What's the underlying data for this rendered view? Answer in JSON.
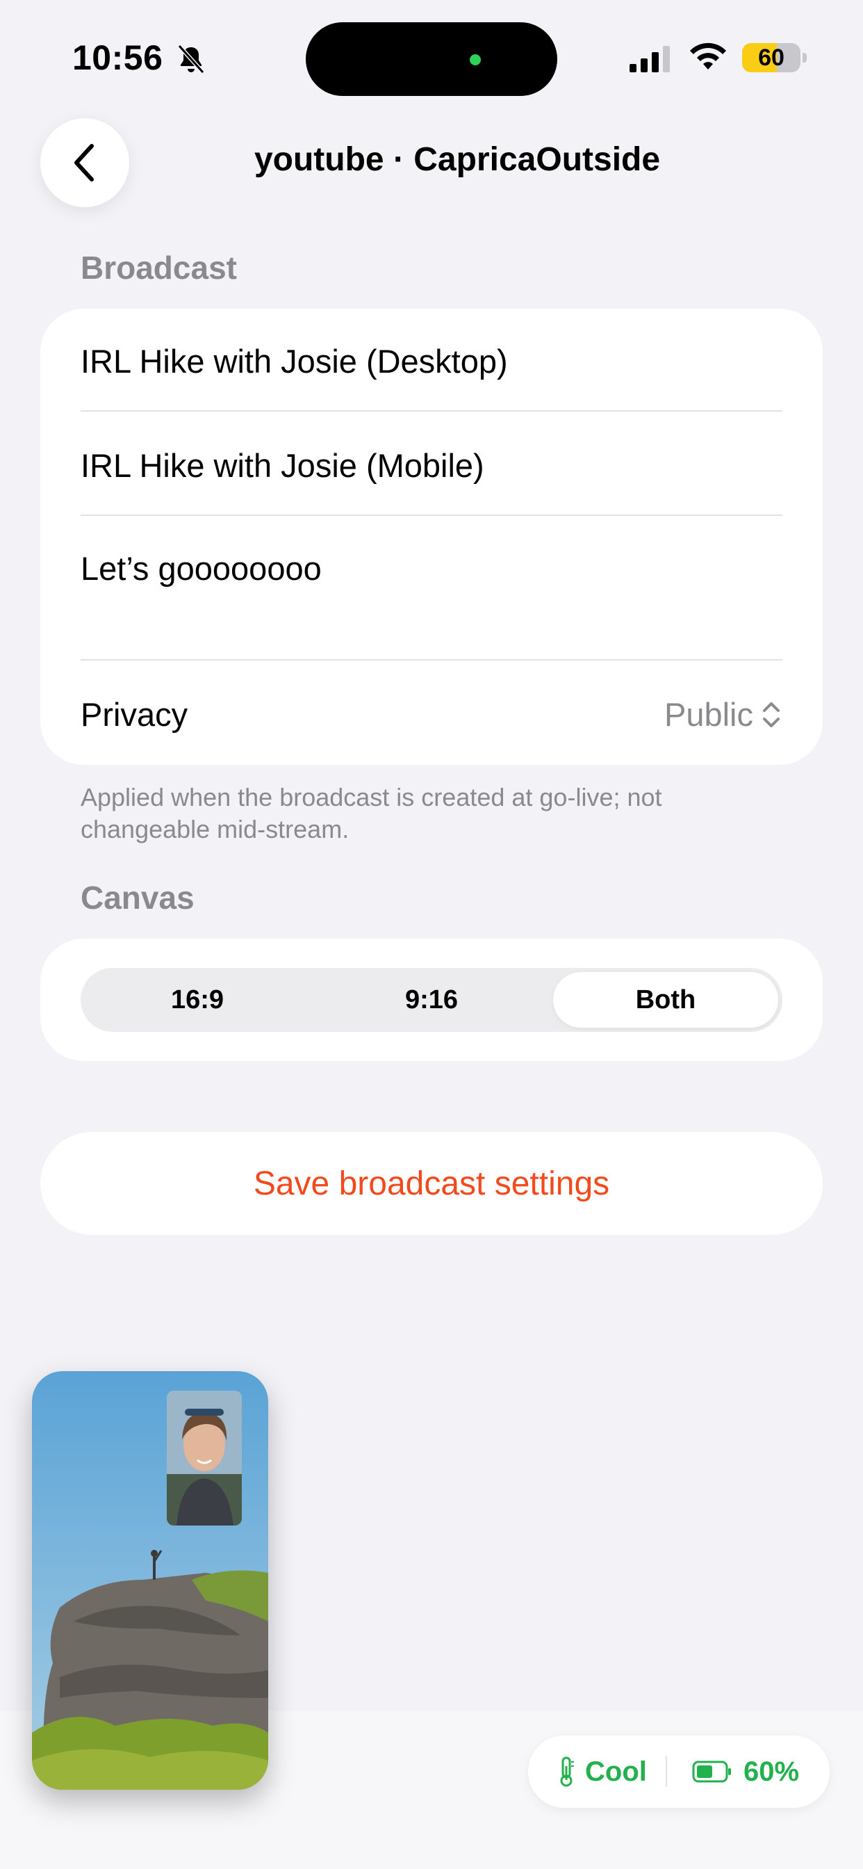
{
  "status_bar": {
    "time": "10:56",
    "battery_percent_label": "60",
    "battery_level": 0.6,
    "icons": [
      "bell-slash-icon",
      "signal-icon",
      "wifi-icon",
      "battery-icon"
    ]
  },
  "nav": {
    "title": "youtube · CapricaOutside",
    "back_icon": "chevron-left-icon"
  },
  "broadcast": {
    "header": "Broadcast",
    "desktop_title": "IRL Hike with Josie (Desktop)",
    "mobile_title": "IRL Hike with Josie (Mobile)",
    "description": "Let’s goooooooo",
    "privacy_label": "Privacy",
    "privacy_value": "Public",
    "footnote": "Applied when the broadcast is created at go-live; not changeable mid-stream."
  },
  "canvas": {
    "header": "Canvas",
    "options": [
      "16:9",
      "9:16",
      "Both"
    ],
    "selected": "Both"
  },
  "save_button": "Save broadcast settings",
  "status_pill": {
    "thermal": "Cool",
    "battery": "60%"
  },
  "colors": {
    "accent": "#f24a1d",
    "status_green": "#22b14c",
    "background": "#f2f2f7",
    "secondary_text": "#8a8a8e"
  }
}
